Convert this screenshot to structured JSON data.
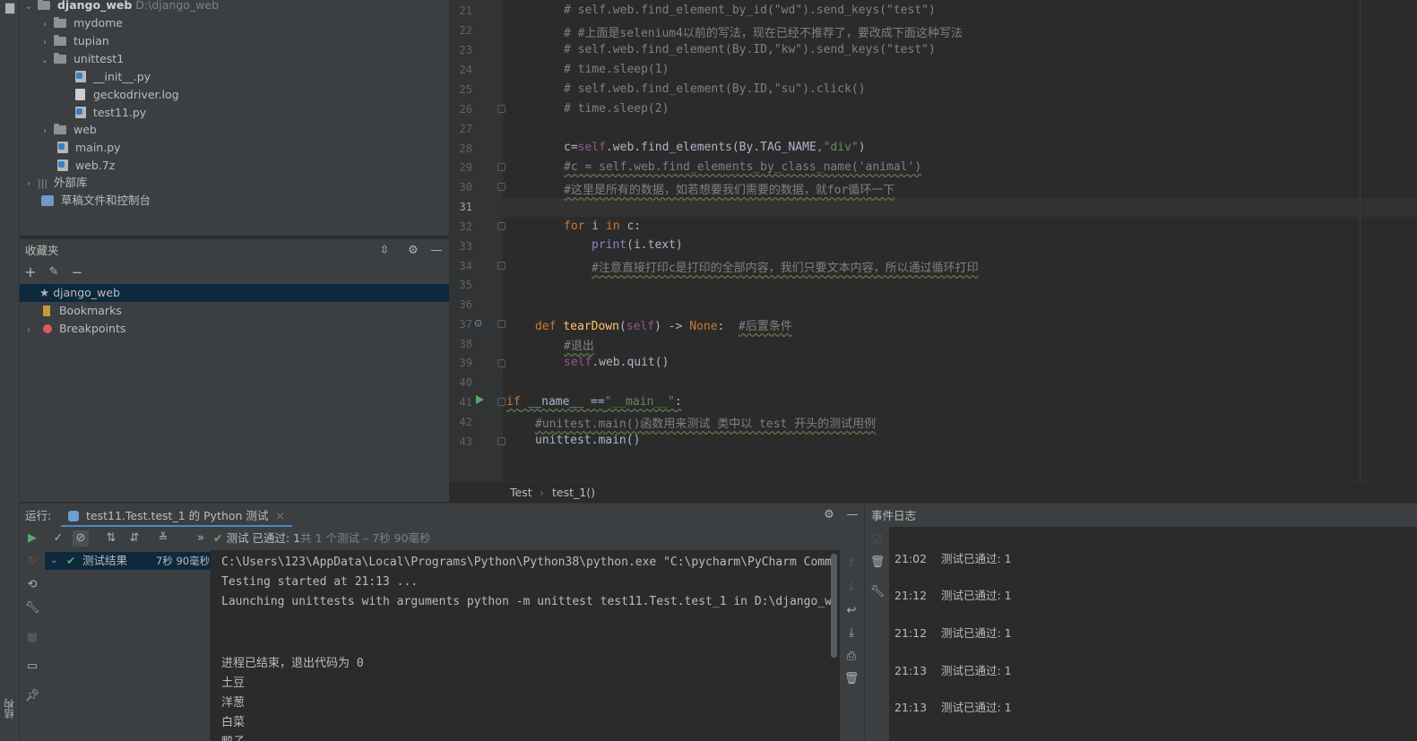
{
  "project": {
    "root_name": "django_web",
    "root_path": "D:\\django_web",
    "items": [
      {
        "label": "mydome",
        "type": "folder",
        "collapsed": true
      },
      {
        "label": "tupian",
        "type": "folder",
        "collapsed": true
      },
      {
        "label": "unittest1",
        "type": "folder",
        "collapsed": false
      },
      {
        "label": "__init__.py",
        "type": "py"
      },
      {
        "label": "geckodriver.log",
        "type": "log"
      },
      {
        "label": "test11.py",
        "type": "py"
      },
      {
        "label": "web",
        "type": "folder",
        "collapsed": true
      },
      {
        "label": "main.py",
        "type": "py"
      },
      {
        "label": "web.7z",
        "type": "archive"
      },
      {
        "label": "外部库",
        "type": "library"
      },
      {
        "label": "草稿文件和控制台",
        "type": "scratches"
      }
    ]
  },
  "favorites": {
    "title": "收藏夹",
    "items": [
      {
        "label": "django_web"
      },
      {
        "label": "Bookmarks"
      },
      {
        "label": "Breakpoints"
      }
    ]
  },
  "editor": {
    "line_numbers": [
      "21",
      "22",
      "23",
      "24",
      "25",
      "26",
      "27",
      "28",
      "29",
      "30",
      "31",
      "32",
      "33",
      "34",
      "35",
      "36",
      "37",
      "38",
      "39",
      "40",
      "41",
      "42",
      "43"
    ],
    "lines": {
      "l21": "# self.web.find_element_by_id(\"wd\").send_keys(\"test\")",
      "l22": "# #上面是selenium4以前的写法，现在已经不推荐了，要改成下面这种写法",
      "l23": "# self.web.find_element(By.ID,\"kw\").send_keys(\"test\")",
      "l24": "# time.sleep(1)",
      "l25": "# self.web.find_element(By.ID,\"su\").click()",
      "l26": "# time.sleep(2)",
      "l28_a": "c=",
      "l28_b": "self",
      "l28_c": ".web.find_elements(By.TAG_NAME",
      "l28_d": ",",
      "l28_e": "\"div\"",
      "l28_f": ")",
      "l29": "#c = self.web.find_elements_by_class_name('animal')",
      "l30": "#这里是所有的数据，如若想要我们需要的数据，就for循环一下",
      "l32_a": "for",
      "l32_b": " i ",
      "l32_c": "in",
      "l32_d": " c:",
      "l33_a": "print",
      "l33_b": "(i.text)",
      "l34": "#注意直接打印c是打印的全部内容，我们只要文本内容，所以通过循环打印",
      "l37_a": "def",
      "l37_b": "tearDown",
      "l37_c": "(",
      "l37_d": "self",
      "l37_e": ") -> ",
      "l37_f": "None",
      "l37_g": ":",
      "l37_h": "#后置条件",
      "l38": "#退出",
      "l39_a": "self",
      "l39_b": ".web.quit()",
      "l41_a": "if",
      "l41_b": " __name__ ==",
      "l41_c": "\"__main__\"",
      "l41_d": ":",
      "l42": "#unitest.main()函数用来测试 类中以 test 开头的测试用例",
      "l43": "unittest.main()"
    },
    "breadcrumb": [
      "Test",
      "test_1()"
    ]
  },
  "run": {
    "label": "运行:",
    "tab_title": "test11.Test.test_1 的 Python 测试",
    "status_main": "测试 已通过:",
    "status_count": "1",
    "status_detail": "共 1 个测试 – 7秒 90毫秒",
    "tree_item": "测试结果",
    "tree_time": "7秒 90毫秒",
    "console": [
      "C:\\Users\\123\\AppData\\Local\\Programs\\Python\\Python38\\python.exe \"C:\\pycharm\\PyCharm Comm",
      "Testing started at 21:13 ...",
      "Launching unittests with arguments python -m unittest test11.Test.test_1 in D:\\django_w",
      "",
      "进程已结束，退出代码为 0",
      "土豆",
      "洋葱",
      "白菜",
      "鸭子"
    ]
  },
  "event_log": {
    "title": "事件日志",
    "events": [
      {
        "time": "21:02",
        "text": "测试已通过: 1"
      },
      {
        "time": "21:12",
        "text": "测试已通过: 1"
      },
      {
        "time": "21:12",
        "text": "测试已通过: 1"
      },
      {
        "time": "21:13",
        "text": "测试已通过: 1"
      },
      {
        "time": "21:13",
        "text": "测试已通过: 1"
      }
    ]
  },
  "side_label": "结构"
}
